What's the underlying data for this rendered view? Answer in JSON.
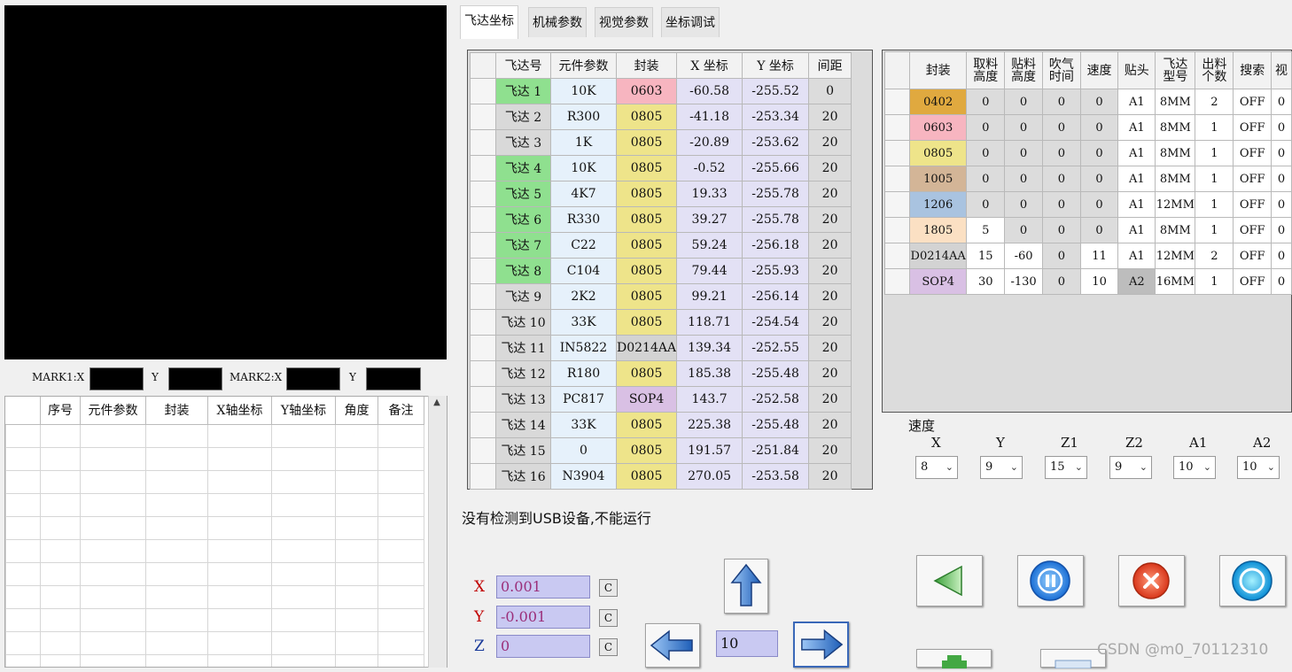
{
  "marks": {
    "mark1_x_label": "MARK1:X",
    "mark1_y_label": "Y",
    "mark2_x_label": "MARK2:X",
    "mark2_y_label": "Y"
  },
  "left_list": {
    "headers": [
      "",
      "序号",
      "元件参数",
      "封装",
      "X轴坐标",
      "Y轴坐标",
      "角度",
      "备注"
    ]
  },
  "tabs": [
    "飞达坐标",
    "机械参数",
    "视觉参数",
    "坐标调试"
  ],
  "feeder_table": {
    "headers": [
      "",
      "飞达号",
      "元件参数",
      "封装",
      "X 坐标",
      "Y 坐标",
      "间距"
    ],
    "rows": [
      {
        "feeder": "飞达 1",
        "part": "10K",
        "pkg": "0603",
        "x": "-60.58",
        "y": "-255.52",
        "pitch": "0",
        "green": true
      },
      {
        "feeder": "飞达 2",
        "part": "R300",
        "pkg": "0805",
        "x": "-41.18",
        "y": "-253.34",
        "pitch": "20",
        "green": false
      },
      {
        "feeder": "飞达 3",
        "part": "1K",
        "pkg": "0805",
        "x": "-20.89",
        "y": "-253.62",
        "pitch": "20",
        "green": false
      },
      {
        "feeder": "飞达 4",
        "part": "10K",
        "pkg": "0805",
        "x": "-0.52",
        "y": "-255.66",
        "pitch": "20",
        "green": true
      },
      {
        "feeder": "飞达 5",
        "part": "4K7",
        "pkg": "0805",
        "x": "19.33",
        "y": "-255.78",
        "pitch": "20",
        "green": true
      },
      {
        "feeder": "飞达 6",
        "part": "R330",
        "pkg": "0805",
        "x": "39.27",
        "y": "-255.78",
        "pitch": "20",
        "green": true
      },
      {
        "feeder": "飞达 7",
        "part": "C22",
        "pkg": "0805",
        "x": "59.24",
        "y": "-256.18",
        "pitch": "20",
        "green": true
      },
      {
        "feeder": "飞达 8",
        "part": "C104",
        "pkg": "0805",
        "x": "79.44",
        "y": "-255.93",
        "pitch": "20",
        "green": true
      },
      {
        "feeder": "飞达 9",
        "part": "2K2",
        "pkg": "0805",
        "x": "99.21",
        "y": "-256.14",
        "pitch": "20",
        "green": false
      },
      {
        "feeder": "飞达 10",
        "part": "33K",
        "pkg": "0805",
        "x": "118.71",
        "y": "-254.54",
        "pitch": "20",
        "green": false
      },
      {
        "feeder": "飞达 11",
        "part": "IN5822",
        "pkg": "D0214AA",
        "x": "139.34",
        "y": "-252.55",
        "pitch": "20",
        "green": false
      },
      {
        "feeder": "飞达 12",
        "part": "R180",
        "pkg": "0805",
        "x": "185.38",
        "y": "-255.48",
        "pitch": "20",
        "green": false
      },
      {
        "feeder": "飞达 13",
        "part": "PC817",
        "pkg": "SOP4",
        "x": "143.7",
        "y": "-252.58",
        "pitch": "20",
        "green": false
      },
      {
        "feeder": "飞达 14",
        "part": "33K",
        "pkg": "0805",
        "x": "225.38",
        "y": "-255.48",
        "pitch": "20",
        "green": false
      },
      {
        "feeder": "飞达 15",
        "part": "0",
        "pkg": "0805",
        "x": "191.57",
        "y": "-251.84",
        "pitch": "20",
        "green": false
      },
      {
        "feeder": "飞达 16",
        "part": "N3904",
        "pkg": "0805",
        "x": "270.05",
        "y": "-253.58",
        "pitch": "20",
        "green": false
      }
    ]
  },
  "package_table": {
    "headers": [
      "",
      "封装",
      "取料高度",
      "贴料高度",
      "吹气时间",
      "速度",
      "贴头",
      "飞达型号",
      "出料个数",
      "搜索",
      "视"
    ],
    "rows": [
      {
        "pkg": "0402",
        "pick_h": "0",
        "place_h": "0",
        "blow": "0",
        "speed": "0",
        "head": "A1",
        "feeder_type": "8MM",
        "count": "2",
        "search": "OFF",
        "last": "0"
      },
      {
        "pkg": "0603",
        "pick_h": "0",
        "place_h": "0",
        "blow": "0",
        "speed": "0",
        "head": "A1",
        "feeder_type": "8MM",
        "count": "1",
        "search": "OFF",
        "last": "0"
      },
      {
        "pkg": "0805",
        "pick_h": "0",
        "place_h": "0",
        "blow": "0",
        "speed": "0",
        "head": "A1",
        "feeder_type": "8MM",
        "count": "1",
        "search": "OFF",
        "last": "0"
      },
      {
        "pkg": "1005",
        "pick_h": "0",
        "place_h": "0",
        "blow": "0",
        "speed": "0",
        "head": "A1",
        "feeder_type": "8MM",
        "count": "1",
        "search": "OFF",
        "last": "0"
      },
      {
        "pkg": "1206",
        "pick_h": "0",
        "place_h": "0",
        "blow": "0",
        "speed": "0",
        "head": "A1",
        "feeder_type": "12MM",
        "count": "1",
        "search": "OFF",
        "last": "0"
      },
      {
        "pkg": "1805",
        "pick_h": "5",
        "place_h": "0",
        "blow": "0",
        "speed": "0",
        "head": "A1",
        "feeder_type": "8MM",
        "count": "1",
        "search": "OFF",
        "last": "0"
      },
      {
        "pkg": "D0214AA",
        "pick_h": "15",
        "place_h": "-60",
        "blow": "0",
        "speed": "11",
        "head": "A1",
        "feeder_type": "12MM",
        "count": "2",
        "search": "OFF",
        "last": "0"
      },
      {
        "pkg": "SOP4",
        "pick_h": "30",
        "place_h": "-130",
        "blow": "0",
        "speed": "10",
        "head": "A2",
        "feeder_type": "16MM",
        "count": "1",
        "search": "OFF",
        "last": "0"
      }
    ]
  },
  "package_colors": {
    "0402": "#e0a93f",
    "0603": "#f7b5c0",
    "0805": "#eee48a",
    "1005": "#d3b597",
    "1206": "#a9c3e0",
    "1805": "#fbe0c3",
    "D0214AA": "#d3d3d3",
    "SOP4": "#d9c0e4"
  },
  "speed": {
    "title": "速度",
    "axes": [
      {
        "label": "X",
        "value": "8"
      },
      {
        "label": "Y",
        "value": "9"
      },
      {
        "label": "Z1",
        "value": "15"
      },
      {
        "label": "Z2",
        "value": "9"
      },
      {
        "label": "A1",
        "value": "10"
      },
      {
        "label": "A2",
        "value": "10"
      }
    ]
  },
  "status": "没有检测到USB设备,不能运行",
  "jog": {
    "x_label": "X",
    "x_value": "0.001",
    "y_label": "Y",
    "y_value": "-0.001",
    "z_label": "Z",
    "z_value": "0",
    "clear_label": "C",
    "step_value": "10"
  },
  "icons": {
    "up": "arrow-up-icon",
    "left": "arrow-left-icon",
    "right": "arrow-right-icon",
    "back": "triangle-left-icon",
    "pause": "pause-icon",
    "stop": "stop-icon",
    "run": "circle-icon"
  },
  "watermark": "CSDN @m0_70112310"
}
